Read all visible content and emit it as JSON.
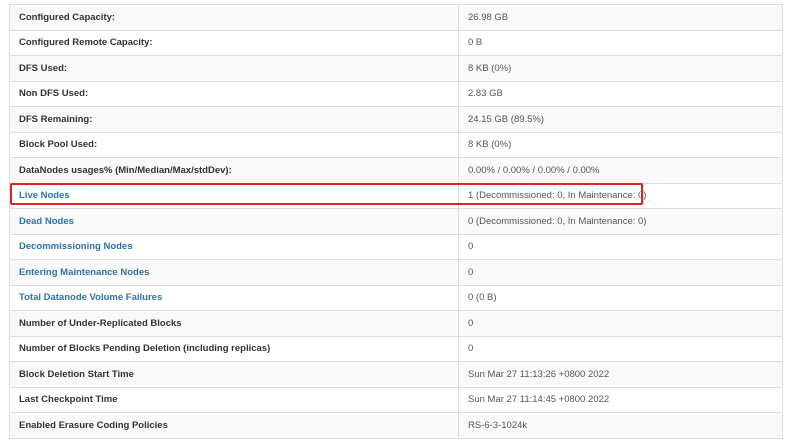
{
  "summary": {
    "rows": [
      {
        "label": "Configured Capacity:",
        "value": "26.98 GB",
        "link": false
      },
      {
        "label": "Configured Remote Capacity:",
        "value": "0 B",
        "link": false
      },
      {
        "label": "DFS Used:",
        "value": "8 KB (0%)",
        "link": false
      },
      {
        "label": "Non DFS Used:",
        "value": "2.83 GB",
        "link": false
      },
      {
        "label": "DFS Remaining:",
        "value": "24.15 GB (89.5%)",
        "link": false
      },
      {
        "label": "Block Pool Used:",
        "value": "8 KB (0%)",
        "link": false
      },
      {
        "label": "DataNodes usages% (Min/Median/Max/stdDev):",
        "value": "0.00% / 0.00% / 0.00% / 0.00%",
        "link": false
      },
      {
        "label": "Live Nodes",
        "value": "1 (Decommissioned: 0, In Maintenance: 0)",
        "link": true
      },
      {
        "label": "Dead Nodes",
        "value": "0 (Decommissioned: 0, In Maintenance: 0)",
        "link": true
      },
      {
        "label": "Decommissioning Nodes",
        "value": "0",
        "link": true
      },
      {
        "label": "Entering Maintenance Nodes",
        "value": "0",
        "link": true
      },
      {
        "label": "Total Datanode Volume Failures",
        "value": "0 (0 B)",
        "link": true
      },
      {
        "label": "Number of Under-Replicated Blocks",
        "value": "0",
        "link": false
      },
      {
        "label": "Number of Blocks Pending Deletion (including replicas)",
        "value": "0",
        "link": false
      },
      {
        "label": "Block Deletion Start Time",
        "value": "Sun Mar 27 11:13:26 +0800 2022",
        "link": false
      },
      {
        "label": "Last Checkpoint Time",
        "value": "Sun Mar 27 11:14:45 +0800 2022",
        "link": false
      },
      {
        "label": "Enabled Erasure Coding Policies",
        "value": "RS-6-3-1024k",
        "link": false
      }
    ]
  },
  "colors": {
    "link": "#3071a9",
    "highlight": "#e0231e",
    "stripe": "#f9f9f9",
    "border": "#dddddd"
  }
}
